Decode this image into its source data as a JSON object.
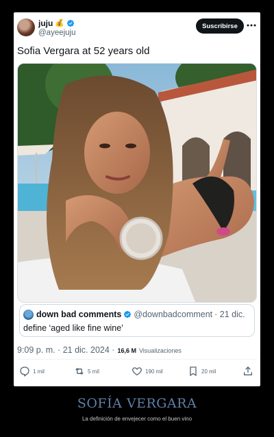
{
  "post": {
    "author": {
      "display_name": "juju",
      "handle": "@ayeejuju",
      "emoji": "💰"
    },
    "subscribe_label": "Suscribirse",
    "text": "Sofia Vergara at 52 years old",
    "quote": {
      "display_name": "down bad comments",
      "handle": "@downbadcomment",
      "date": "· 21 dic.",
      "text": "define ‘aged like fine wine’"
    },
    "meta": {
      "time_date": "9:09 p. m. · 21 dic. 2024 ·",
      "views_count": "16,6 M",
      "views_label": "Visualizaciones"
    },
    "actions": {
      "replies": "1 mil",
      "reposts": "5 mil",
      "likes": "190 mil",
      "bookmarks": "20 mil"
    },
    "colors": {
      "verified": "#1d9bf0",
      "text": "#0f1419",
      "secondary": "#536471"
    }
  },
  "caption": {
    "title": "SOFÍA VERGARA",
    "subtitle": "La definición de envejecer como el buen vino",
    "title_color": "#5f80a8"
  }
}
